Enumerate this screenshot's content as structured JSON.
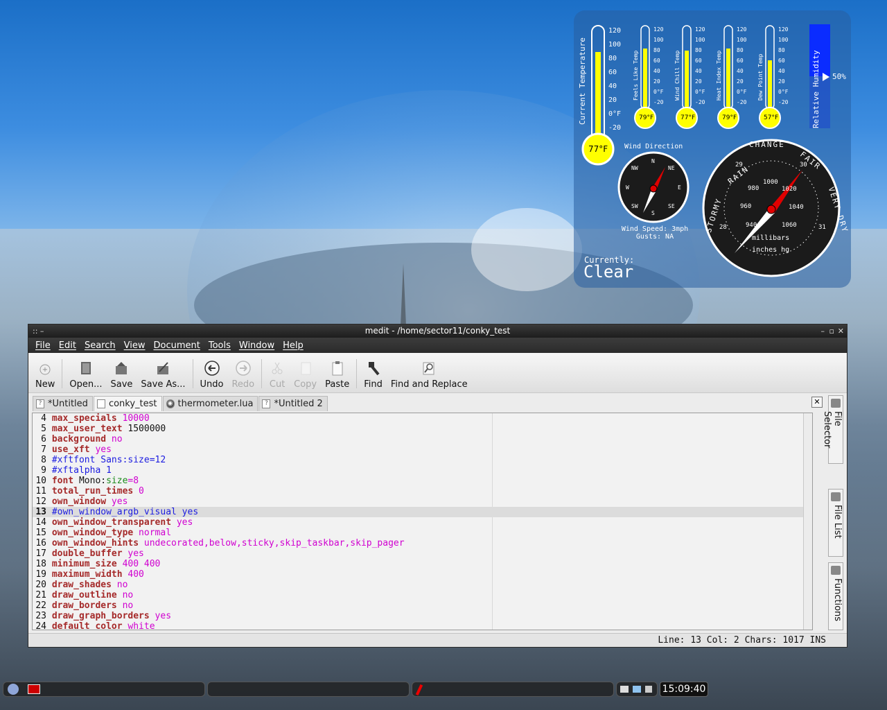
{
  "conky": {
    "thermometers": [
      {
        "label": "Current Temperature",
        "value": "77°F"
      },
      {
        "label": "Feels Like Temp",
        "value": "79°F"
      },
      {
        "label": "Wind Chill Temp",
        "value": "77°F"
      },
      {
        "label": "Heat Index Temp",
        "value": "79°F"
      },
      {
        "label": "Dew Point Temp",
        "value": "57°F"
      }
    ],
    "scale_large": [
      "120",
      "100",
      "80",
      "60",
      "40",
      "20",
      "0°F",
      "-20"
    ],
    "scale_small": [
      "120",
      "100",
      "80",
      "60",
      "40",
      "20",
      "0°F",
      "-20"
    ],
    "humidity": {
      "label": "Relative Humidity",
      "value": "50%",
      "fraction": 0.5
    },
    "wind_direction_title": "Wind Direction",
    "compass": [
      "N",
      "NE",
      "E",
      "SE",
      "S",
      "SW",
      "W",
      "NW"
    ],
    "wind_speed": "Wind Speed: 3mph",
    "gusts": "Gusts: NA",
    "barometer": {
      "words": [
        "STORMY",
        "RAIN",
        "CHANGE",
        "FAIR",
        "VERY DRY"
      ],
      "millibar_ticks": [
        "940",
        "960",
        "980",
        "1000",
        "1020",
        "1040",
        "1060"
      ],
      "inch_ticks": [
        "28",
        "29",
        "30",
        "31"
      ],
      "unit_mb": "millibars",
      "unit_in": "inches hg"
    },
    "currently_label": "Currently:",
    "currently_value": "Clear"
  },
  "window": {
    "title": "medit - /home/sector11/conky_test",
    "title_left": "::  –",
    "controls": [
      "–",
      "▫",
      "✕"
    ]
  },
  "menu": [
    "File",
    "Edit",
    "Search",
    "View",
    "Document",
    "Tools",
    "Window",
    "Help"
  ],
  "toolbar": {
    "new": "New",
    "open": "Open...",
    "save": "Save",
    "save_as": "Save As...",
    "undo": "Undo",
    "redo": "Redo",
    "cut": "Cut",
    "copy": "Copy",
    "paste": "Paste",
    "find": "Find",
    "find_replace": "Find and Replace"
  },
  "tabs": [
    "*Untitled",
    "conky_test",
    "thermometer.lua",
    "*Untitled 2"
  ],
  "tab_close": "✕",
  "code": [
    {
      "n": "4",
      "key": "max_specials",
      "rest": " 10000",
      "rest_class": "val"
    },
    {
      "n": "5",
      "key": "max_user_text",
      "rest": " 1500000",
      "rest_class": "plain"
    },
    {
      "n": "6",
      "key": "background",
      "rest": " no",
      "rest_class": "val"
    },
    {
      "n": "7",
      "key": "use_xft",
      "rest": " yes",
      "rest_class": "val"
    },
    {
      "n": "8",
      "comment": "#xftfont Sans:size=12"
    },
    {
      "n": "9",
      "comment": "#xftalpha 1"
    },
    {
      "n": "10",
      "key": "font",
      "rest": " Mono:",
      "rest_class": "plain",
      "extra": "size",
      "extra2": "=8"
    },
    {
      "n": "11",
      "key": "total_run_times",
      "rest": " 0",
      "rest_class": "val"
    },
    {
      "n": "12",
      "key": "own_window",
      "rest": " yes",
      "rest_class": "val"
    },
    {
      "n": "13",
      "comment": "#own_window_argb_visual yes",
      "current": true
    },
    {
      "n": "14",
      "key": "own_window_transparent",
      "rest": " yes",
      "rest_class": "val"
    },
    {
      "n": "15",
      "key": "own_window_type",
      "rest": " normal",
      "rest_class": "val"
    },
    {
      "n": "16",
      "key": "own_window_hints",
      "rest": " undecorated,below,sticky,skip_taskbar,skip_pager",
      "rest_class": "val"
    },
    {
      "n": "17",
      "key": "double_buffer",
      "rest": " yes",
      "rest_class": "val"
    },
    {
      "n": "18",
      "key": "minimum_size",
      "rest": " 400 400",
      "rest_class": "val"
    },
    {
      "n": "19",
      "key": "maximum_width",
      "rest": " 400",
      "rest_class": "val"
    },
    {
      "n": "20",
      "key": "draw_shades",
      "rest": " no",
      "rest_class": "val"
    },
    {
      "n": "21",
      "key": "draw_outline",
      "rest": " no",
      "rest_class": "val"
    },
    {
      "n": "22",
      "key": "draw_borders",
      "rest": " no",
      "rest_class": "val"
    },
    {
      "n": "23",
      "key": "draw_graph_borders",
      "rest": " yes",
      "rest_class": "val"
    },
    {
      "n": "24",
      "key": "default_color",
      "rest": " white",
      "rest_class": "val"
    }
  ],
  "side_tabs": [
    "File Selector",
    "File List",
    "Functions"
  ],
  "status": "Line: 13 Col: 2  Chars: 1017  INS",
  "clock": "15:09:40"
}
